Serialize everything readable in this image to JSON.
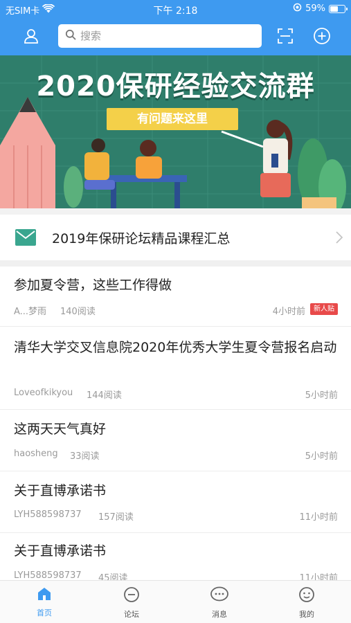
{
  "status_bar": {
    "carrier": "无SIM卡",
    "time": "下午 2:18",
    "battery": "59%",
    "battery_level": 0.59
  },
  "header": {
    "search_placeholder": "搜索",
    "icons": [
      "user-icon",
      "search-icon",
      "scan-icon",
      "add-icon"
    ]
  },
  "banner": {
    "title": "2020保研经验交流群",
    "subtitle": "有问题来这里"
  },
  "featured": {
    "title": "2019年保研论坛精品课程汇总",
    "icon": "mail-icon"
  },
  "posts": [
    {
      "title": "参加夏令营，这些工作得做",
      "author": "A...梦雨",
      "reads": "140阅读",
      "time": "4小时前",
      "badge": "新人贴"
    },
    {
      "title": "清华大学交叉信息院2020年优秀大学生夏令营报名启动",
      "author": "Loveofkikyou",
      "reads": "144阅读",
      "time": "5小时前"
    },
    {
      "title": "这两天天气真好",
      "author": "haosheng",
      "reads": "33阅读",
      "time": "5小时前"
    },
    {
      "title": "关于直博承诺书",
      "author": "LYH588598737",
      "reads": "157阅读",
      "time": "11小时前"
    },
    {
      "title": "关于直博承诺书",
      "author": "LYH588598737",
      "reads": "45阅读",
      "time": "11小时前"
    }
  ],
  "tabbar": {
    "tabs": [
      {
        "label": "首页",
        "icon": "home-icon",
        "active": true
      },
      {
        "label": "论坛",
        "icon": "forum-icon",
        "active": false
      },
      {
        "label": "消息",
        "icon": "message-icon",
        "active": false
      },
      {
        "label": "我的",
        "icon": "profile-icon",
        "active": false
      }
    ]
  },
  "colors": {
    "primary": "#3e9af0",
    "badge": "#e84a4a",
    "banner_bg": "#2f7e6b",
    "banner_accent": "#f4d049",
    "featured_icon": "#3aa68f"
  }
}
